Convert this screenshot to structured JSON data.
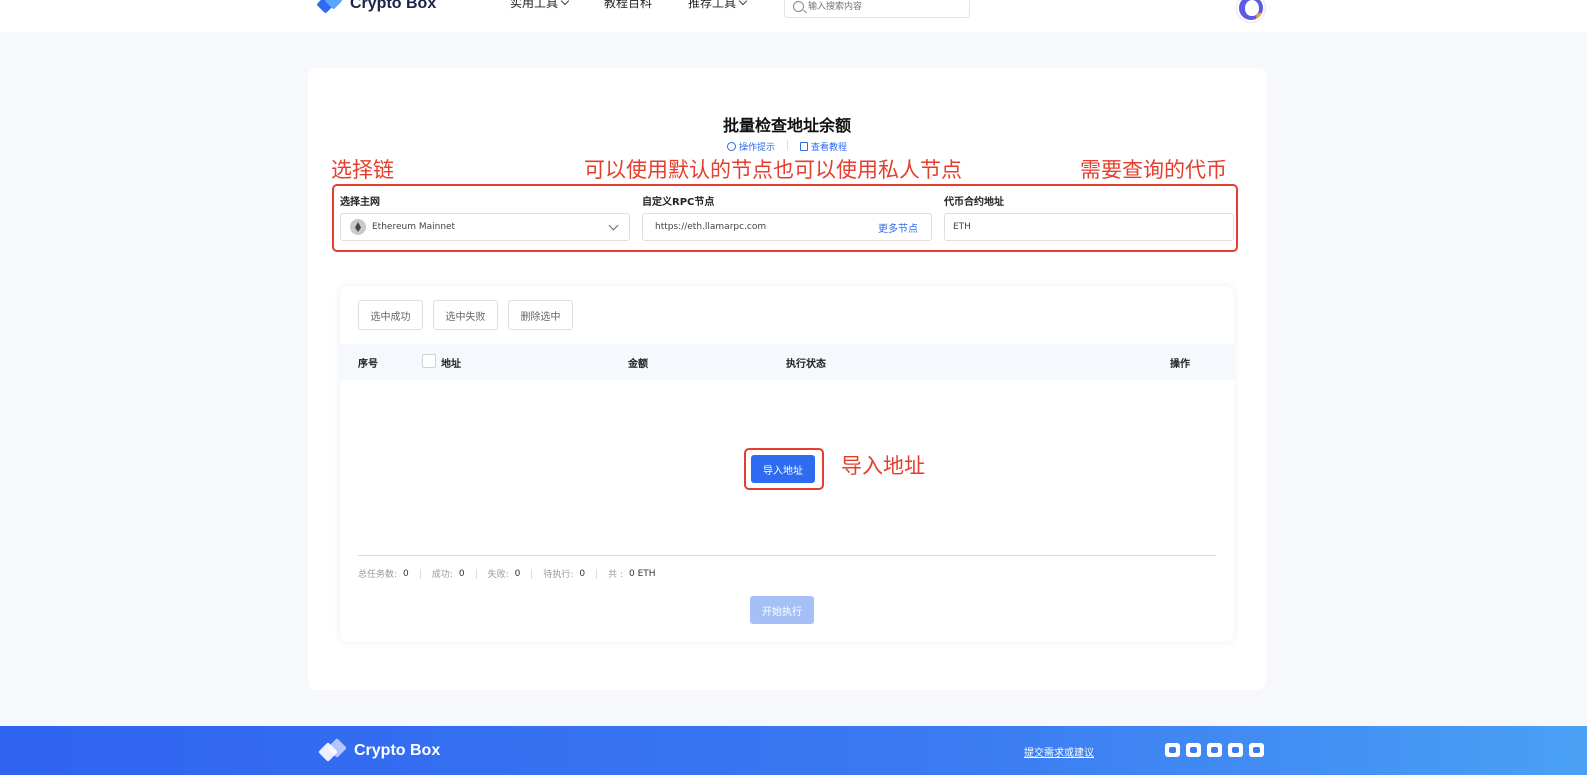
{
  "header": {
    "logo_text": "Crypto Box",
    "nav": [
      "实用工具",
      "教程百科",
      "推荐工具"
    ],
    "search_placeholder": "输入搜索内容"
  },
  "page": {
    "title": "批量检查地址余额",
    "tips_link": "操作提示",
    "tutorial_link": "查看教程"
  },
  "annotations": {
    "select_chain": "选择链",
    "rpc_note": "可以使用默认的节点也可以使用私人节点",
    "token_note": "需要查询的代币",
    "import_note": "导入地址"
  },
  "form": {
    "network_label": "选择主网",
    "network_value": "Ethereum Mainnet",
    "rpc_label": "自定义RPC节点",
    "rpc_value": "https://eth.llamarpc.com",
    "more_nodes": "更多节点",
    "token_label": "代币合约地址",
    "token_value": "ETH"
  },
  "toolbar": {
    "select_success": "选中成功",
    "select_fail": "选中失败",
    "delete_selected": "删除选中"
  },
  "table": {
    "col_index": "序号",
    "col_address": "地址",
    "col_amount": "金额",
    "col_status": "执行状态",
    "col_action": "操作"
  },
  "import_button": "导入地址",
  "stats": {
    "total_label": "总任务数:",
    "total": "0",
    "success_label": "成功:",
    "success": "0",
    "fail_label": "失败:",
    "fail": "0",
    "pending_label": "待执行:",
    "pending": "0",
    "sum_label": "共 :",
    "sum": "0 ETH"
  },
  "start_button": "开始执行",
  "footer": {
    "logo_text": "Crypto Box",
    "feedback": "提交需求或建议",
    "social_icons": [
      "wechat-icon",
      "email-icon",
      "telegram-icon",
      "twitter-icon",
      "youtube-icon"
    ]
  },
  "colors": {
    "accent": "#2f6bf0",
    "annotation_red": "#e53e2e",
    "start_disabled": "#a5c0f7"
  }
}
